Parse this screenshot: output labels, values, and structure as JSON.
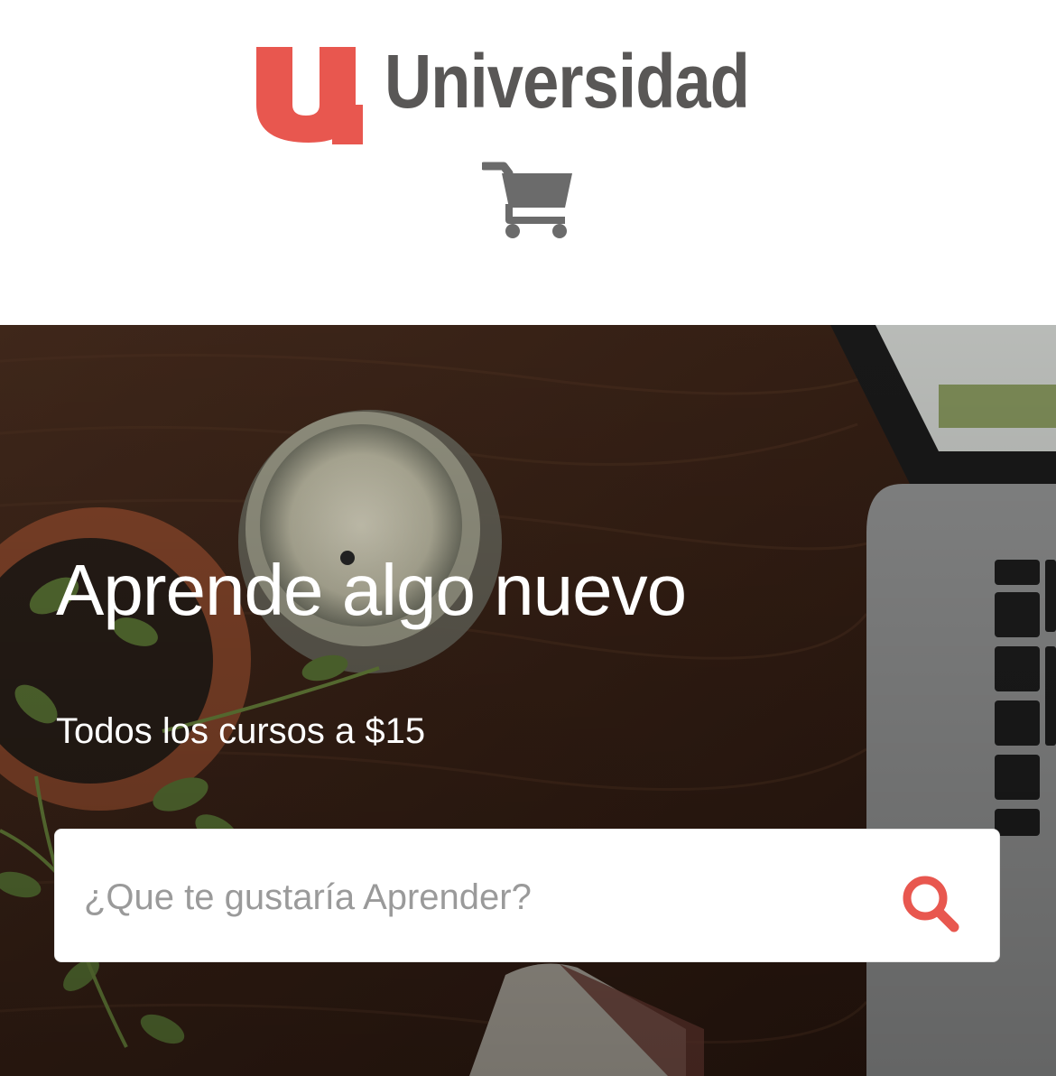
{
  "header": {
    "logo_text": "Universidad",
    "logo_mark_letter": "u",
    "cart_icon": "shopping-cart-icon"
  },
  "hero": {
    "title": "Aprende algo nuevo",
    "subtitle": "Todos los cursos a $15"
  },
  "search": {
    "placeholder": "¿Que te gustaría Aprender?",
    "value": "",
    "icon": "search-icon"
  },
  "colors": {
    "brand_red": "#e8574f",
    "logo_gray": "#595756",
    "cart_gray": "#6b6b6b",
    "hero_bg": "#3b2418",
    "text_on_hero": "#ffffff",
    "placeholder_gray": "#9a9a9a"
  }
}
